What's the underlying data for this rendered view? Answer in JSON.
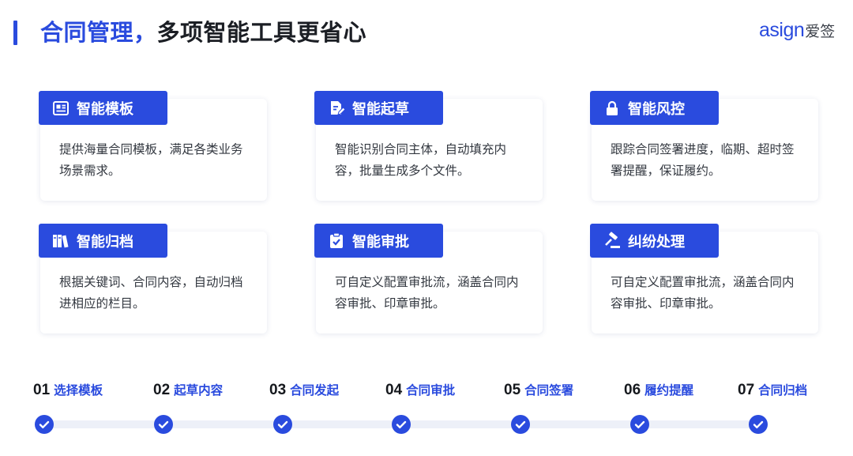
{
  "header": {
    "title_accent": "合同管理，",
    "title_rest": "多项智能工具更省心",
    "logo_latin": "asign",
    "logo_cn": "爱签"
  },
  "features": [
    {
      "label": "智能模板",
      "icon": "template-icon",
      "desc": "提供海量合同模板，满足各类业务场景需求。"
    },
    {
      "label": "智能起草",
      "icon": "draft-icon",
      "desc": "智能识别合同主体，自动填充内容，批量生成多个文件。"
    },
    {
      "label": "智能风控",
      "icon": "lock-icon",
      "desc": "跟踪合同签署进度，临期、超时签署提醒，保证履约。"
    },
    {
      "label": "智能归档",
      "icon": "archive-icon",
      "desc": "根据关键词、合同内容，自动归档进相应的栏目。"
    },
    {
      "label": "智能审批",
      "icon": "approval-clipboard-icon",
      "desc": "可自定义配置审批流，涵盖合同内容审批、印章审批。"
    },
    {
      "label": "纠纷处理",
      "icon": "gavel-icon",
      "desc": "可自定义配置审批流，涵盖合同内容审批、印章审批。"
    }
  ],
  "steps": [
    {
      "num": "01",
      "label": "选择模板"
    },
    {
      "num": "02",
      "label": "起草内容"
    },
    {
      "num": "03",
      "label": "合同发起"
    },
    {
      "num": "04",
      "label": "合同审批"
    },
    {
      "num": "05",
      "label": "合同签署"
    },
    {
      "num": "06",
      "label": "履约提醒"
    },
    {
      "num": "07",
      "label": "合同归档"
    }
  ],
  "colors": {
    "accent": "#2a4bde",
    "track": "#edf0f8",
    "text": "#1b1e24"
  }
}
